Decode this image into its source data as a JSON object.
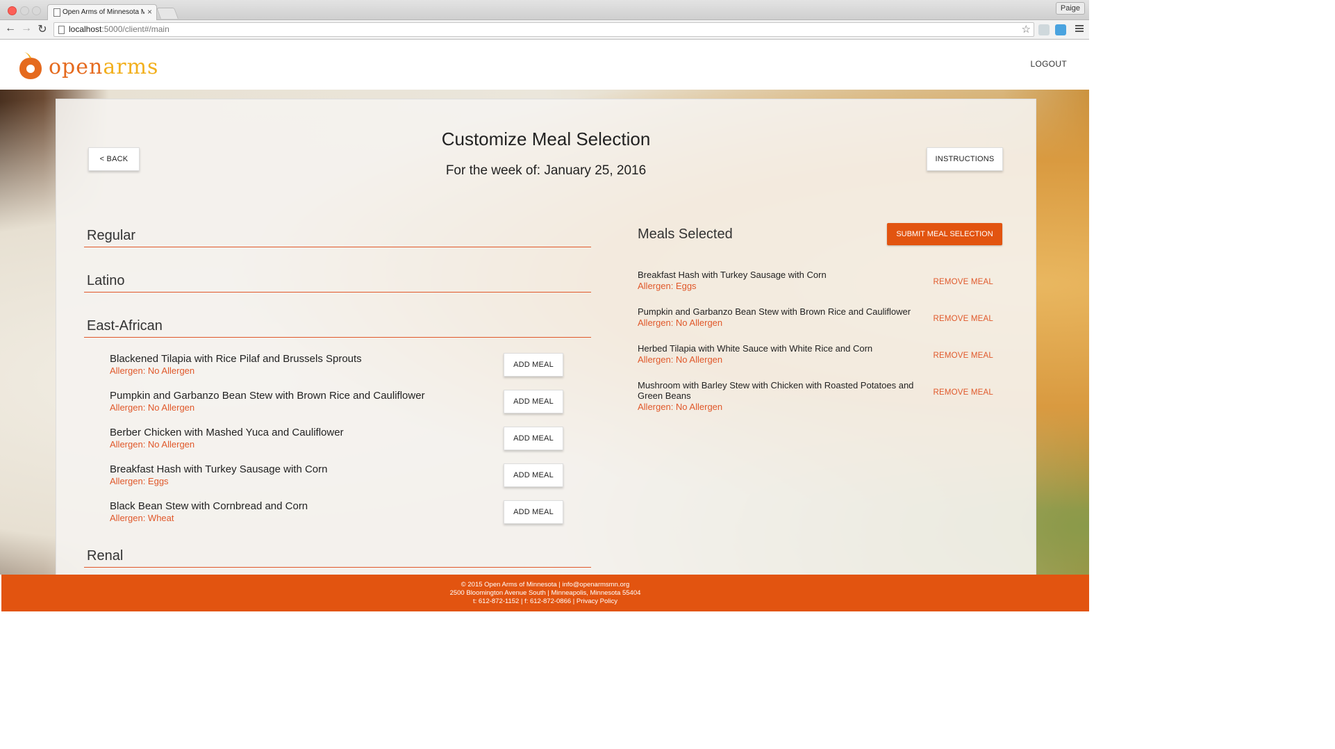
{
  "browser": {
    "tab_title": "Open Arms of Minnesota M",
    "tab_close": "×",
    "profile": "Paige",
    "url_host": "localhost",
    "url_path": ":5000/client#/main",
    "back": "←",
    "forward": "→",
    "reload": "↻",
    "star": "☆"
  },
  "header": {
    "logo_part1": "open",
    "logo_part2": "arms",
    "logout": "LOGOUT"
  },
  "main": {
    "title": "Customize Meal Selection",
    "week": "For the week of: January 25, 2016",
    "back_label": "< BACK",
    "instructions_label": "INSTRUCTIONS",
    "categories": [
      {
        "label": "Regular"
      },
      {
        "label": "Latino"
      },
      {
        "label": "East-African"
      },
      {
        "label": "Renal"
      }
    ],
    "meals": [
      {
        "name": "Blackened Tilapia with Rice Pilaf and Brussels Sprouts",
        "allergen": "Allergen: No Allergen",
        "button": "ADD MEAL"
      },
      {
        "name": "Pumpkin and Garbanzo Bean Stew with Brown Rice and Cauliflower",
        "allergen": "Allergen: No Allergen",
        "button": "ADD MEAL"
      },
      {
        "name": "Berber Chicken with Mashed Yuca and Cauliflower",
        "allergen": "Allergen: No Allergen",
        "button": "ADD MEAL"
      },
      {
        "name": "Breakfast Hash with Turkey Sausage with Corn",
        "allergen": "Allergen: Eggs",
        "button": "ADD MEAL"
      },
      {
        "name": "Black Bean Stew with Cornbread and Corn",
        "allergen": "Allergen: Wheat",
        "button": "ADD MEAL"
      }
    ],
    "selected_title": "Meals Selected",
    "submit_label": "SUBMIT MEAL SELECTION",
    "selected": [
      {
        "name": "Breakfast Hash with Turkey Sausage with Corn",
        "allergen": "Allergen: Eggs",
        "remove": "REMOVE MEAL"
      },
      {
        "name": "Pumpkin and Garbanzo Bean Stew with Brown Rice and Cauliflower",
        "allergen": "Allergen: No Allergen",
        "remove": "REMOVE MEAL"
      },
      {
        "name": "Herbed Tilapia with White Sauce with White Rice and Corn",
        "allergen": "Allergen: No Allergen",
        "remove": "REMOVE MEAL"
      },
      {
        "name": "Mushroom with Barley Stew with Chicken with Roasted Potatoes and Green Beans",
        "allergen": "Allergen: No Allergen",
        "remove": "REMOVE MEAL"
      }
    ]
  },
  "footer": {
    "line1": "© 2015 Open Arms of Minnesota | info@openarmsmn.org",
    "line2": "2500 Bloomington Avenue South | Minneapolis, Minnesota 55404",
    "line3": "t: 612-872-1152 | f: 612-872-0866 | Privacy Policy"
  },
  "colors": {
    "accent": "#e25410",
    "allergen": "#e0582a",
    "logo_orange": "#e56a1e",
    "logo_yellow": "#f2b01e"
  }
}
